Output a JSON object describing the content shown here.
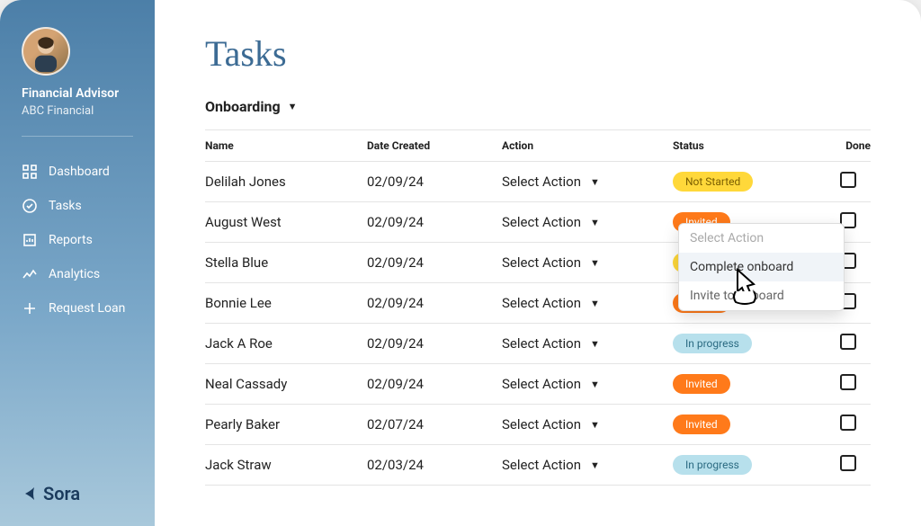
{
  "sidebar": {
    "user_role": "Financial Advisor",
    "user_org": "ABC Financial",
    "nav": [
      {
        "label": "Dashboard",
        "icon": "dashboard-icon"
      },
      {
        "label": "Tasks",
        "icon": "tasks-icon"
      },
      {
        "label": "Reports",
        "icon": "reports-icon"
      },
      {
        "label": "Analytics",
        "icon": "analytics-icon"
      },
      {
        "label": "Request Loan",
        "icon": "plus-icon"
      }
    ],
    "brand": "Sora"
  },
  "main": {
    "title": "Tasks",
    "filter_label": "Onboarding",
    "columns": {
      "name": "Name",
      "date": "Date Created",
      "action": "Action",
      "status": "Status",
      "done": "Done"
    },
    "action_placeholder": "Select Action",
    "dropdown": {
      "items": [
        "Select Action",
        "Complete onboard",
        "Invite to onboard"
      ]
    },
    "rows": [
      {
        "name": "Delilah Jones",
        "date": "02/09/24",
        "status": "Not Started",
        "status_key": "not-started"
      },
      {
        "name": "August West",
        "date": "02/09/24",
        "status": "Invited",
        "status_key": "invited"
      },
      {
        "name": "Stella Blue",
        "date": "02/09/24",
        "status": "Not Started",
        "status_key": "not-started"
      },
      {
        "name": "Bonnie Lee",
        "date": "02/09/24",
        "status": "Invited",
        "status_key": "invited"
      },
      {
        "name": "Jack A Roe",
        "date": "02/09/24",
        "status": "In progress",
        "status_key": "inprogress"
      },
      {
        "name": "Neal Cassady",
        "date": "02/09/24",
        "status": "Invited",
        "status_key": "invited"
      },
      {
        "name": "Pearly Baker",
        "date": "02/07/24",
        "status": "Invited",
        "status_key": "invited"
      },
      {
        "name": "Jack Straw",
        "date": "02/03/24",
        "status": "In progress",
        "status_key": "inprogress"
      }
    ]
  },
  "colors": {
    "accent": "#3c6b94",
    "sidebar_top": "#4c7fa8",
    "sidebar_bottom": "#a8c8db",
    "badge_not_started": "#ffd83a",
    "badge_invited": "#ff7a1a",
    "badge_inprogress": "#b7e0ec"
  }
}
